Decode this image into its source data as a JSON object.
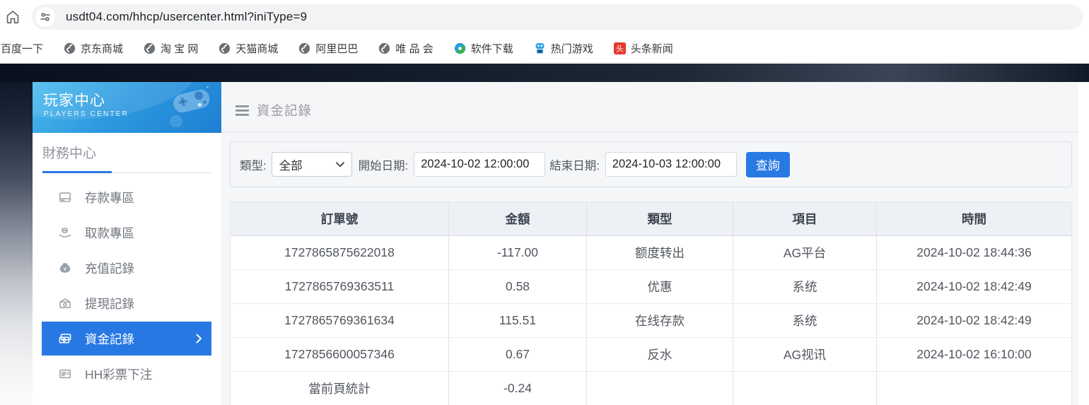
{
  "browser": {
    "url": "usdt04.com/hhcp/usercenter.html?iniType=9",
    "bookmarks": [
      {
        "label": "百度一下",
        "icon": "none"
      },
      {
        "label": "京东商城",
        "icon": "globe-icon"
      },
      {
        "label": "淘 宝 网",
        "icon": "globe-icon"
      },
      {
        "label": "天猫商城",
        "icon": "globe-icon"
      },
      {
        "label": "阿里巴巴",
        "icon": "globe-icon"
      },
      {
        "label": "唯 品 会",
        "icon": "globe-icon"
      },
      {
        "label": "软件下载",
        "icon": "software-download-icon"
      },
      {
        "label": "热门游戏",
        "icon": "hot-games-icon"
      },
      {
        "label": "头条新闻",
        "icon": "toutiao-news-icon"
      }
    ]
  },
  "sidebar": {
    "title": "玩家中心",
    "subtitle": "PLAYERS CENTER",
    "section_title": "財務中心",
    "items": [
      {
        "label": "存款專區",
        "icon": "deposit-icon",
        "active": false
      },
      {
        "label": "取款專區",
        "icon": "withdraw-icon",
        "active": false
      },
      {
        "label": "充值記錄",
        "icon": "recharge-record-icon",
        "active": false
      },
      {
        "label": "提現記錄",
        "icon": "withdrawal-record-icon",
        "active": false
      },
      {
        "label": "資金記錄",
        "icon": "funds-record-icon",
        "active": true
      },
      {
        "label": "HH彩票下注",
        "icon": "lottery-bets-icon",
        "active": false
      }
    ]
  },
  "main": {
    "page_title": "資金記錄",
    "filters": {
      "type_label": "類型:",
      "type_value": "全部",
      "start_label": "開始日期:",
      "start_value": "2024-10-02 12:00:00",
      "end_label": "結束日期:",
      "end_value": "2024-10-03 12:00:00",
      "query_button": "查詢"
    },
    "table": {
      "columns": [
        "訂單號",
        "金額",
        "類型",
        "項目",
        "時間"
      ],
      "rows": [
        [
          "1727865875622018",
          "-117.00",
          "额度转出",
          "AG平台",
          "2024-10-02 18:44:36"
        ],
        [
          "1727865769363511",
          "0.58",
          "优惠",
          "系统",
          "2024-10-02 18:42:49"
        ],
        [
          "1727865769361634",
          "115.51",
          "在线存款",
          "系统",
          "2024-10-02 18:42:49"
        ],
        [
          "1727856600057346",
          "0.67",
          "反水",
          "AG视讯",
          "2024-10-02 16:10:00"
        ],
        [
          "當前頁統計",
          "-0.24",
          "",
          "",
          ""
        ]
      ]
    }
  },
  "colors": {
    "accent_blue": "#2979e5",
    "sidebar_active_bg": "#2878e4",
    "sidebar_header_top": "#4cbbee",
    "sidebar_header_bottom": "#1e7fd2",
    "content_bg": "#f4f6f8",
    "table_header_bg": "#edf0f4",
    "table_border_pink": "#f3dcdc",
    "dark_band": "#131c2b",
    "toutiao_red": "#e5372e"
  }
}
